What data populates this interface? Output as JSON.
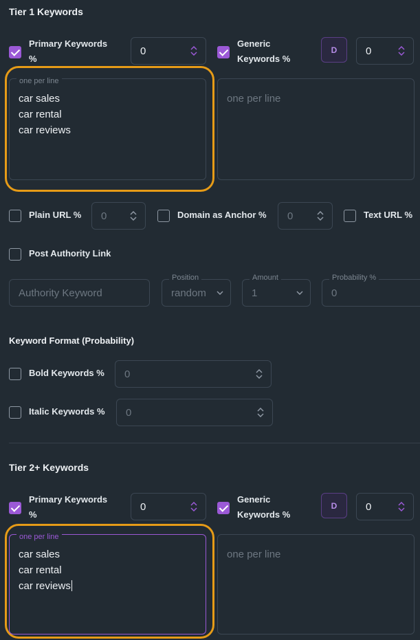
{
  "tier1": {
    "heading": "Tier 1 Keywords",
    "primary_label": "Primary Keywords %",
    "primary_value": "0",
    "generic_label": "Generic Keywords %",
    "generic_value": "0",
    "d_button": "D",
    "primary_legend": "one per line",
    "primary_lines": [
      "car sales",
      "car rental",
      "car reviews"
    ],
    "generic_placeholder": "one per line"
  },
  "url_options": {
    "plain_url_label": "Plain URL %",
    "plain_url_value": "0",
    "domain_anchor_label": "Domain as Anchor %",
    "domain_anchor_value": "0",
    "text_url_label": "Text URL %"
  },
  "authority": {
    "post_authority_label": "Post Authority Link",
    "keyword_placeholder": "Authority Keyword",
    "position_label": "Position",
    "position_value": "random",
    "amount_label": "Amount",
    "amount_value": "1",
    "probability_label": "Probability %",
    "probability_value": "0"
  },
  "format": {
    "heading": "Keyword Format (Probability)",
    "bold_label": "Bold Keywords %",
    "bold_value": "0",
    "italic_label": "Italic Keywords %",
    "italic_value": "0"
  },
  "tier2": {
    "heading": "Tier 2+ Keywords",
    "primary_label": "Primary Keywords %",
    "primary_value": "0",
    "generic_label": "Generic Keywords %",
    "generic_value": "0",
    "d_button": "D",
    "primary_legend": "one per line",
    "primary_lines": [
      "car sales",
      "car rental",
      "car reviews"
    ],
    "generic_placeholder": "one per line"
  },
  "colors": {
    "accent": "#9b59d6",
    "highlight": "#e69b17",
    "background": "#222b33"
  }
}
